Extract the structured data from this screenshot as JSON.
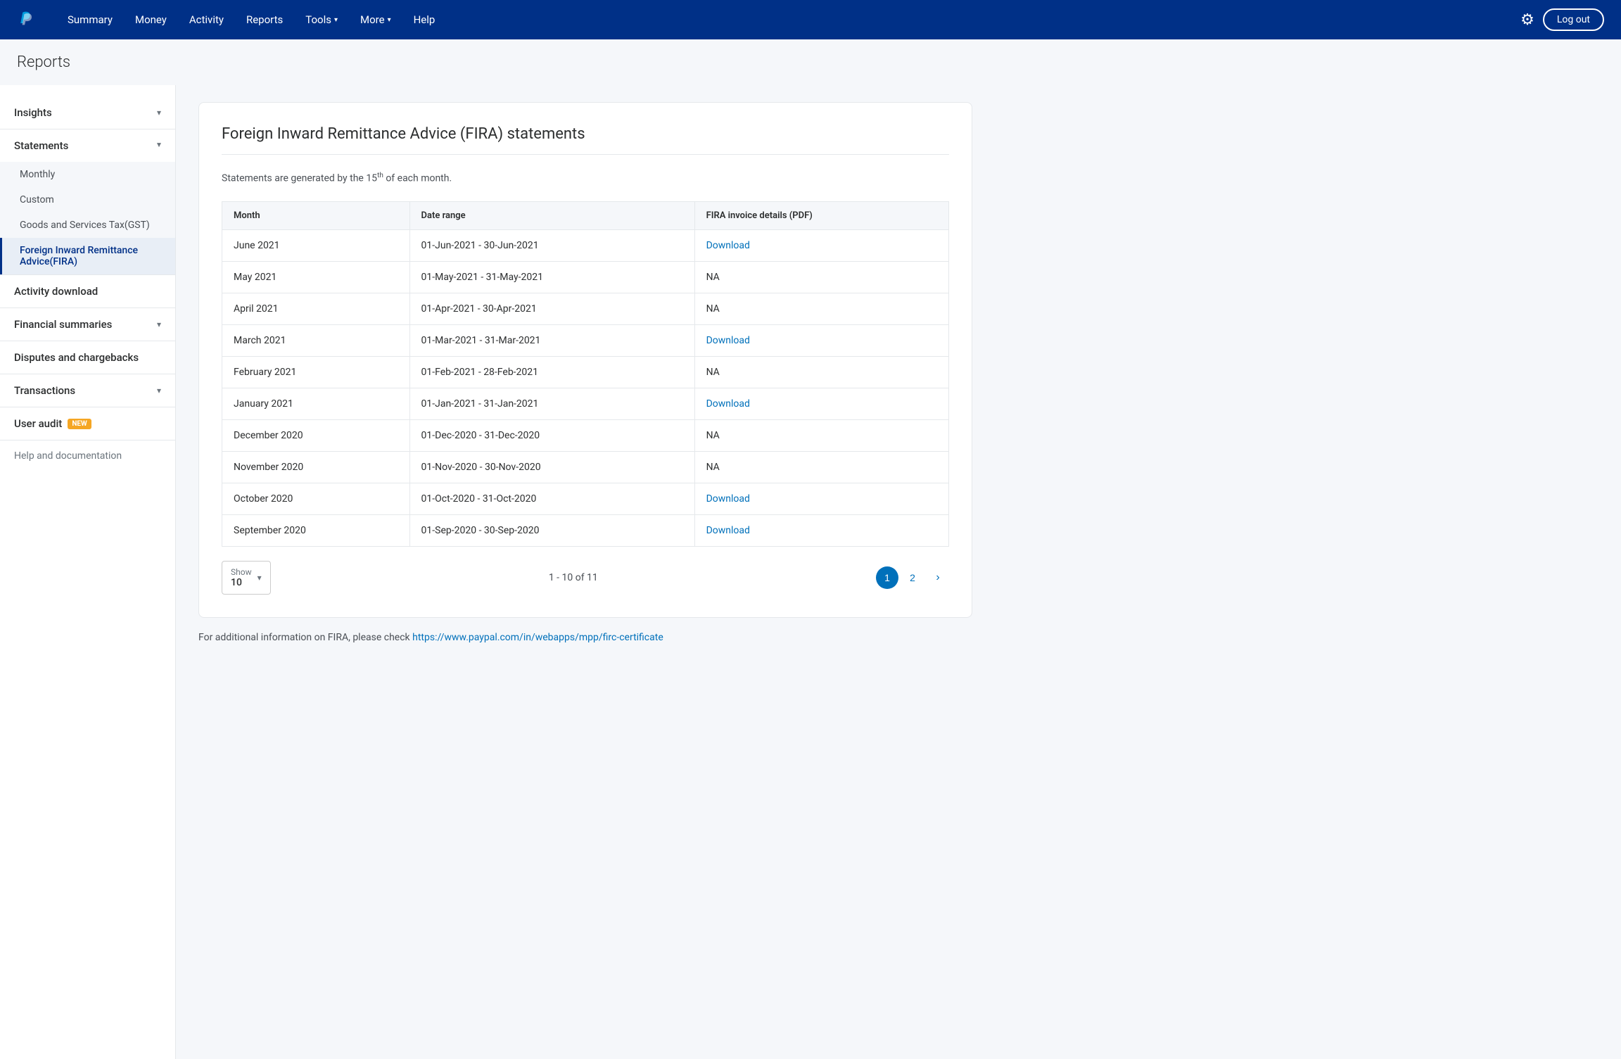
{
  "header": {
    "logo_alt": "PayPal",
    "nav": [
      {
        "label": "Summary",
        "has_dropdown": false
      },
      {
        "label": "Money",
        "has_dropdown": false
      },
      {
        "label": "Activity",
        "has_dropdown": false
      },
      {
        "label": "Reports",
        "has_dropdown": false
      },
      {
        "label": "Tools",
        "has_dropdown": true
      },
      {
        "label": "More",
        "has_dropdown": true
      },
      {
        "label": "Help",
        "has_dropdown": false
      }
    ],
    "logout_label": "Log out"
  },
  "page": {
    "title": "Reports"
  },
  "sidebar": {
    "sections": [
      {
        "label": "Insights",
        "type": "collapsible",
        "open": false,
        "items": []
      },
      {
        "label": "Statements",
        "type": "collapsible",
        "open": true,
        "items": [
          {
            "label": "Monthly",
            "active": false
          },
          {
            "label": "Custom",
            "active": false
          },
          {
            "label": "Goods and Services Tax(GST)",
            "active": false
          },
          {
            "label": "Foreign Inward Remittance Advice(FIRA)",
            "active": true
          }
        ]
      },
      {
        "label": "Activity download",
        "type": "plain"
      },
      {
        "label": "Financial summaries",
        "type": "collapsible",
        "open": false,
        "items": []
      },
      {
        "label": "Disputes and chargebacks",
        "type": "plain"
      },
      {
        "label": "Transactions",
        "type": "collapsible",
        "open": false,
        "items": []
      },
      {
        "label": "User audit",
        "type": "plain",
        "badge": "NEW"
      }
    ],
    "help_label": "Help and documentation"
  },
  "content": {
    "title": "Foreign Inward Remittance Advice (FIRA) statements",
    "subtitle_prefix": "Statements are generated by the 15",
    "subtitle_suffix": " of each month.",
    "superscript": "th",
    "table": {
      "columns": [
        "Month",
        "Date range",
        "FIRA invoice details (PDF)"
      ],
      "rows": [
        {
          "month": "June 2021",
          "date_range": "01-Jun-2021 - 30-Jun-2021",
          "fira": "Download",
          "is_download": true
        },
        {
          "month": "May 2021",
          "date_range": "01-May-2021 - 31-May-2021",
          "fira": "NA",
          "is_download": false
        },
        {
          "month": "April 2021",
          "date_range": "01-Apr-2021 - 30-Apr-2021",
          "fira": "NA",
          "is_download": false
        },
        {
          "month": "March 2021",
          "date_range": "01-Mar-2021 - 31-Mar-2021",
          "fira": "Download",
          "is_download": true
        },
        {
          "month": "February 2021",
          "date_range": "01-Feb-2021 - 28-Feb-2021",
          "fira": "NA",
          "is_download": false
        },
        {
          "month": "January 2021",
          "date_range": "01-Jan-2021 - 31-Jan-2021",
          "fira": "Download",
          "is_download": true
        },
        {
          "month": "December 2020",
          "date_range": "01-Dec-2020 - 31-Dec-2020",
          "fira": "NA",
          "is_download": false
        },
        {
          "month": "November 2020",
          "date_range": "01-Nov-2020 - 30-Nov-2020",
          "fira": "NA",
          "is_download": false
        },
        {
          "month": "October 2020",
          "date_range": "01-Oct-2020 - 31-Oct-2020",
          "fira": "Download",
          "is_download": true
        },
        {
          "month": "September 2020",
          "date_range": "01-Sep-2020 - 30-Sep-2020",
          "fira": "Download",
          "is_download": true
        }
      ]
    },
    "pagination": {
      "show_label": "Show",
      "show_value": "10",
      "page_info": "1 - 10 of 11",
      "current_page": 1,
      "total_pages": 2
    },
    "footer_note_prefix": "For additional information on FIRA, please check ",
    "footer_link": "https://www.paypal.com/in/webapps/mpp/firc-certificate"
  }
}
